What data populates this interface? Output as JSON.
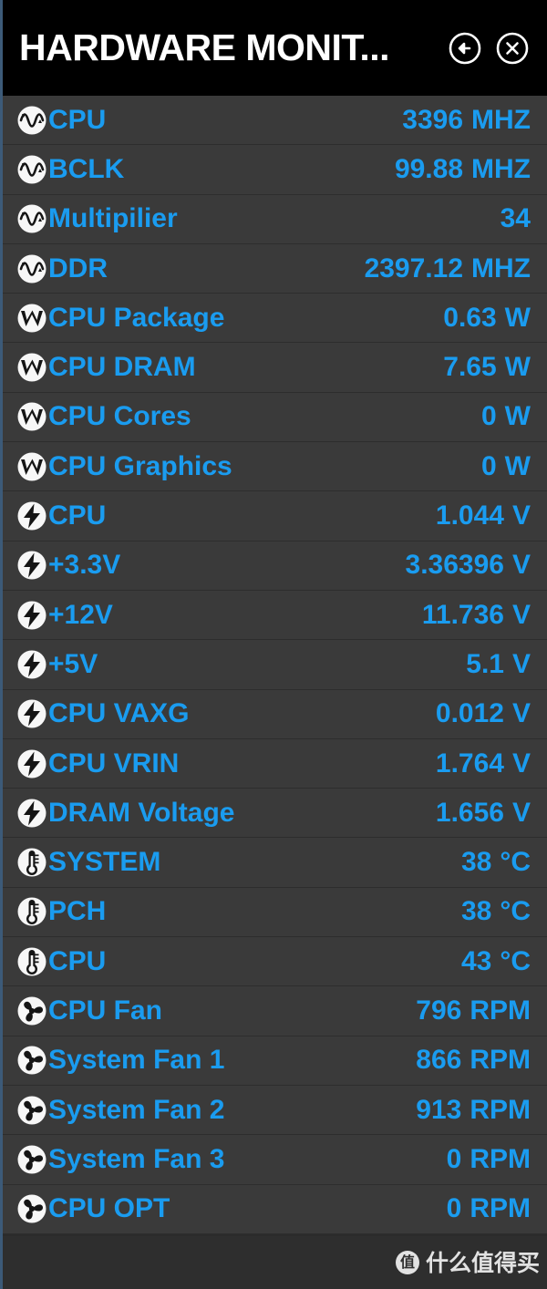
{
  "window": {
    "title": "HARDWARE MONIT...",
    "back_icon": "back-arrow-circle-icon",
    "close_icon": "close-circle-icon",
    "accent_color": "#1a9cf0",
    "title_color": "#ffffff",
    "row_bg_color": "#3a3a3a",
    "titlebar_bg_color": "#000000",
    "border_color": "#3c5a78"
  },
  "rows": [
    {
      "icon": "frequency-waveform-icon",
      "label": "CPU",
      "value": "3396",
      "unit": "MHZ"
    },
    {
      "icon": "frequency-waveform-icon",
      "label": "BCLK",
      "value": "99.88",
      "unit": "MHZ"
    },
    {
      "icon": "frequency-waveform-icon",
      "label": "Multipilier",
      "value": "34",
      "unit": ""
    },
    {
      "icon": "frequency-waveform-icon",
      "label": "DDR",
      "value": "2397.12",
      "unit": "MHZ"
    },
    {
      "icon": "power-watt-icon",
      "label": "CPU Package",
      "value": "0.63",
      "unit": "W"
    },
    {
      "icon": "power-watt-icon",
      "label": "CPU DRAM",
      "value": "7.65",
      "unit": "W"
    },
    {
      "icon": "power-watt-icon",
      "label": "CPU Cores",
      "value": "0",
      "unit": "W"
    },
    {
      "icon": "power-watt-icon",
      "label": "CPU Graphics",
      "value": "0",
      "unit": "W"
    },
    {
      "icon": "voltage-bolt-icon",
      "label": "CPU",
      "value": "1.044",
      "unit": "V"
    },
    {
      "icon": "voltage-bolt-icon",
      "label": "+3.3V",
      "value": "3.36396",
      "unit": "V"
    },
    {
      "icon": "voltage-bolt-icon",
      "label": "+12V",
      "value": "11.736",
      "unit": "V"
    },
    {
      "icon": "voltage-bolt-icon",
      "label": "+5V",
      "value": "5.1",
      "unit": "V"
    },
    {
      "icon": "voltage-bolt-icon",
      "label": "CPU VAXG",
      "value": "0.012",
      "unit": "V"
    },
    {
      "icon": "voltage-bolt-icon",
      "label": "CPU VRIN",
      "value": "1.764",
      "unit": "V"
    },
    {
      "icon": "voltage-bolt-icon",
      "label": "DRAM Voltage",
      "value": "1.656",
      "unit": "V"
    },
    {
      "icon": "temperature-thermometer-icon",
      "label": "SYSTEM",
      "value": "38",
      "unit": "°C"
    },
    {
      "icon": "temperature-thermometer-icon",
      "label": "PCH",
      "value": "38",
      "unit": "°C"
    },
    {
      "icon": "temperature-thermometer-icon",
      "label": "CPU",
      "value": "43",
      "unit": "°C"
    },
    {
      "icon": "fan-icon",
      "label": "CPU Fan",
      "value": "796",
      "unit": "RPM"
    },
    {
      "icon": "fan-icon",
      "label": "System Fan 1",
      "value": "866",
      "unit": "RPM"
    },
    {
      "icon": "fan-icon",
      "label": "System Fan 2",
      "value": "913",
      "unit": "RPM"
    },
    {
      "icon": "fan-icon",
      "label": "System Fan 3",
      "value": "0",
      "unit": "RPM"
    },
    {
      "icon": "fan-icon",
      "label": "CPU OPT",
      "value": "0",
      "unit": "RPM"
    }
  ],
  "footer": {
    "watermark_logo": "值",
    "watermark_text": "什么值得买"
  }
}
